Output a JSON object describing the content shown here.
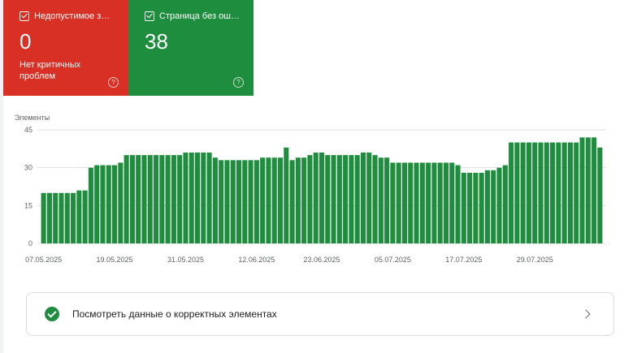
{
  "cards": [
    {
      "label": "Недопустимое з…",
      "value": "0",
      "sub": "Нет критичных проблем",
      "color": "#d93025"
    },
    {
      "label": "Страница без ош…",
      "value": "38",
      "sub": "",
      "color": "#1e8e3e"
    }
  ],
  "help_glyph": "?",
  "chart_data": {
    "type": "bar",
    "ylabel": "Элементы",
    "ylim": [
      0,
      45
    ],
    "yticks": [
      "0",
      "15",
      "30",
      "45"
    ],
    "xtick_labels": [
      "07.05.2025",
      "19.05.2025",
      "31.05.2025",
      "12.06.2025",
      "23.06.2025",
      "05.07.2025",
      "17.07.2025",
      "29.07.2025"
    ],
    "xtick_index": [
      0,
      12,
      24,
      36,
      47,
      59,
      71,
      83
    ],
    "bar_color": "#1e8e3e",
    "values": [
      20,
      20,
      20,
      20,
      20,
      20,
      21,
      21,
      30,
      31,
      31,
      31,
      31,
      32,
      35,
      35,
      35,
      35,
      35,
      35,
      35,
      35,
      35,
      35,
      36,
      36,
      36,
      36,
      36,
      34,
      33,
      33,
      33,
      33,
      33,
      33,
      33,
      34,
      34,
      34,
      34,
      38,
      33,
      34,
      34,
      35,
      36,
      36,
      35,
      35,
      35,
      35,
      35,
      35,
      36,
      36,
      35,
      34,
      34,
      32,
      32,
      32,
      32,
      32,
      32,
      32,
      32,
      32,
      32,
      32,
      31,
      28,
      28,
      28,
      28,
      29,
      29,
      30,
      31,
      40,
      40,
      40,
      40,
      40,
      40,
      40,
      40,
      40,
      40,
      40,
      40,
      42,
      42,
      42,
      38
    ]
  },
  "bottom_link": {
    "label": "Посмотреть данные о корректных элементах"
  }
}
